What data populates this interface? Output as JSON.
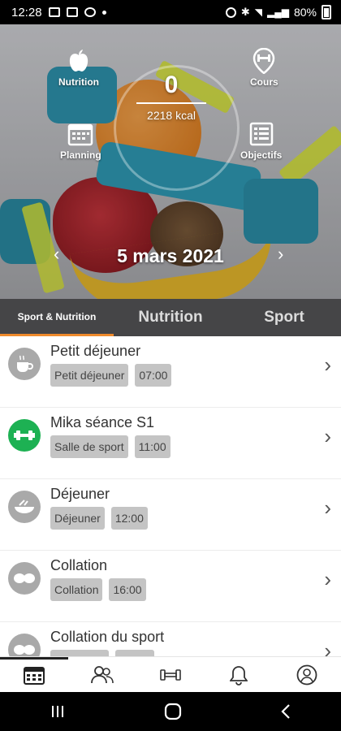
{
  "status_bar": {
    "time": "12:28",
    "battery": "80%"
  },
  "hero": {
    "kcal_value": "0",
    "kcal_label": "2218 kcal",
    "date": "5 mars 2021",
    "buttons": {
      "nutrition": "Nutrition",
      "cours": "Cours",
      "planning": "Planning",
      "objectifs": "Objectifs"
    }
  },
  "tabs": [
    {
      "label": "Sport & Nutrition",
      "active": true
    },
    {
      "label": "Nutrition",
      "active": false
    },
    {
      "label": "Sport",
      "active": false
    }
  ],
  "items": [
    {
      "title": "Petit déjeuner",
      "chips": [
        "Petit déjeuner",
        "07:00"
      ],
      "icon": "coffee-icon"
    },
    {
      "title": "Mika séance S1",
      "chips": [
        "Salle de sport",
        "11:00"
      ],
      "icon": "dumbbell-icon"
    },
    {
      "title": "Déjeuner",
      "chips": [
        "Déjeuner",
        "12:00"
      ],
      "icon": "meal-icon"
    },
    {
      "title": "Collation",
      "chips": [
        "Collation",
        "16:00"
      ],
      "icon": "snack-icon"
    },
    {
      "title": "Collation du sport",
      "chips": [
        "",
        ""
      ],
      "icon": "snack-icon"
    }
  ],
  "bottom_nav": [
    "calendar-icon",
    "group-icon",
    "dumbbell-icon",
    "bell-icon",
    "profile-icon"
  ],
  "colors": {
    "accent": "#ef8a2c",
    "sport_green": "#1db153",
    "tab_bg": "#454547",
    "chip_bg": "#c4c4c4"
  }
}
